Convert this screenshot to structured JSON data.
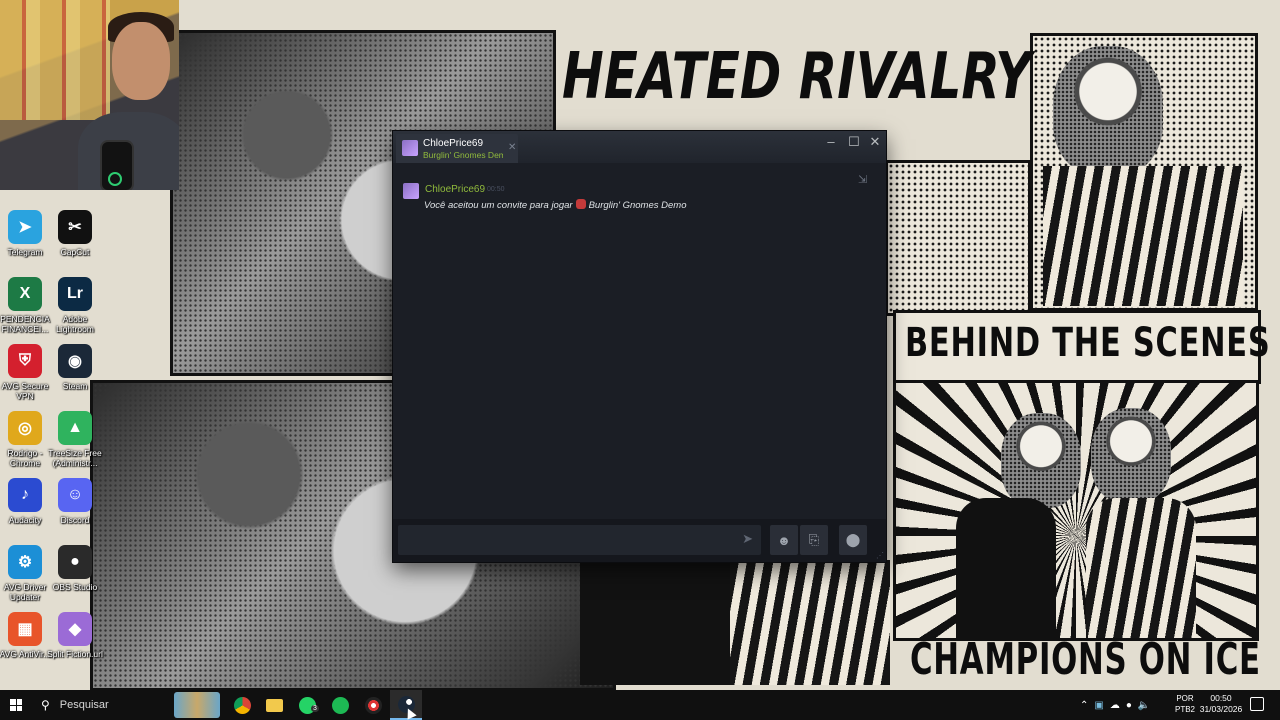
{
  "wallpaper": {
    "headline_top": "HEATED RIVALRY",
    "headline_mid": "BEHIND THE SCENES",
    "headline_bottom": "CHAMPIONS ON ICE"
  },
  "desktop_icons": [
    {
      "label": "Telegram",
      "icon": "telegram-icon",
      "color": "#2aa3df",
      "glyph": "➤"
    },
    {
      "label": "CapCut",
      "icon": "capcut-icon",
      "color": "#111111",
      "glyph": "✂"
    },
    {
      "label": "PENDENCIA FINANCEI...",
      "icon": "excel-icon",
      "color": "#1d7a45",
      "glyph": "X"
    },
    {
      "label": "Adobe Lightroom",
      "icon": "lightroom-icon",
      "color": "#0c2a44",
      "glyph": "Lr"
    },
    {
      "label": "AVG Secure VPN",
      "icon": "avg-vpn-icon",
      "color": "#d4202e",
      "glyph": "⛨"
    },
    {
      "label": "Steam",
      "icon": "steam-icon",
      "color": "#1b2838",
      "glyph": "◉"
    },
    {
      "label": "Rodrigo - Chrome",
      "icon": "chrome-icon",
      "color": "#e0a81c",
      "glyph": "◎"
    },
    {
      "label": "TreeSize Free (Administr...",
      "icon": "treesize-icon",
      "color": "#2fb35e",
      "glyph": "▲"
    },
    {
      "label": "Audacity",
      "icon": "audacity-icon",
      "color": "#2b4bd1",
      "glyph": "♪"
    },
    {
      "label": "Discord",
      "icon": "discord-icon",
      "color": "#5865f2",
      "glyph": "☺"
    },
    {
      "label": "AVG Driver Updater",
      "icon": "avg-driver-icon",
      "color": "#1c8fd6",
      "glyph": "⚙"
    },
    {
      "label": "OBS Studio",
      "icon": "obs-icon",
      "color": "#2a2a2a",
      "glyph": "●"
    },
    {
      "label": "AVG AntiVir...",
      "icon": "avg-antivirus-icon",
      "color": "#e8542a",
      "glyph": "▦"
    },
    {
      "label": "Split Fiction.url",
      "icon": "split-fiction-icon",
      "color": "#9b6bd6",
      "glyph": "◆"
    }
  ],
  "chat": {
    "tab_name": "ChloePrice69",
    "tab_status": "Burglin' Gnomes Demo",
    "message": {
      "author": "ChloePrice69",
      "time": "00:50",
      "text": "Você aceitou um convite para jogar",
      "game": "Burglin' Gnomes Demo"
    }
  },
  "taskbar": {
    "search_placeholder": "Pesquisar",
    "language": "POR",
    "layout": "PTB2",
    "time": "00:50",
    "date": "31/03/2026",
    "whatsapp_badge": "3"
  }
}
